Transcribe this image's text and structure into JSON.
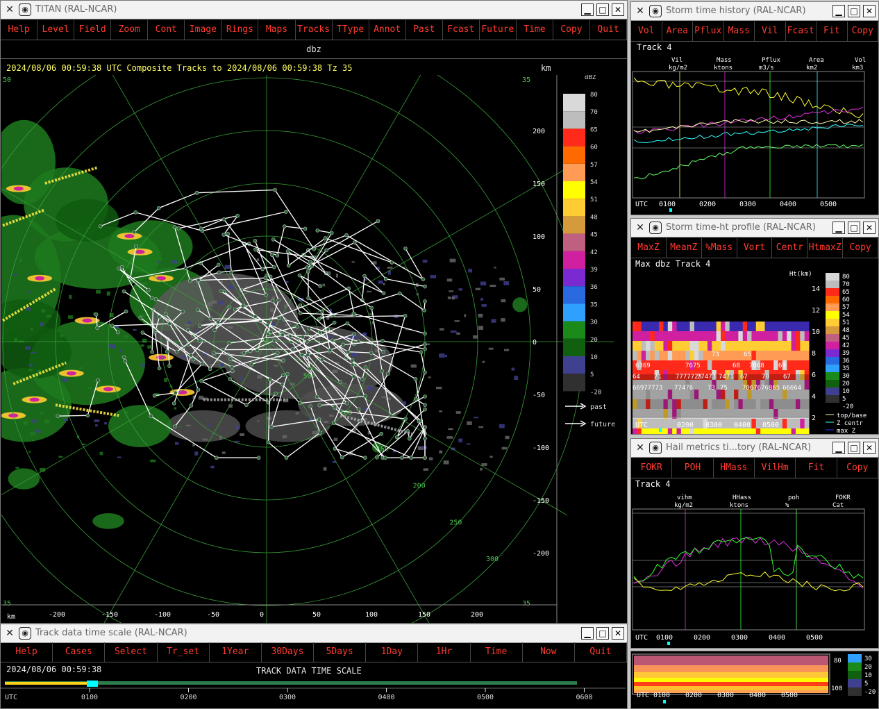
{
  "main": {
    "title": "TITAN (RAL-NCAR)",
    "menu": [
      "Help",
      "Level",
      "Field",
      "Zoom",
      "Cont",
      "Image",
      "Rings",
      "Maps",
      "Tracks",
      "TType",
      "Annot",
      "Past",
      "Fcast",
      "Future",
      "Time",
      "Copy",
      "Quit"
    ],
    "field": "dbz",
    "header": "2024/08/06 00:59:38 UTC Composite Tracks to 2024/08/06 00:59:38 Tz 35",
    "km_top": "km",
    "km_bottom": "km",
    "x_ticks": [
      "-200",
      "-150",
      "-100",
      "-50",
      "0",
      "50",
      "100",
      "150",
      "200"
    ],
    "y_ticks": [
      "200",
      "150",
      "100",
      "50",
      "0",
      "-50",
      "-100",
      "-150",
      "-200"
    ],
    "ring_labels": [
      "50",
      "100",
      "150",
      "200",
      "250",
      "300"
    ],
    "corner_labels": [
      "50",
      "35",
      "35",
      "35"
    ],
    "legend": {
      "unit": "dBZ",
      "levels": [
        "80",
        "70",
        "65",
        "60",
        "57",
        "54",
        "51",
        "48",
        "45",
        "42",
        "39",
        "36",
        "35",
        "30",
        "20",
        "10",
        "5",
        "-20"
      ],
      "colors": [
        "#d9d9d9",
        "#bdbdbd",
        "#ff2a1a",
        "#ff6a00",
        "#ff9b55",
        "#ffff00",
        "#ffcc33",
        "#d49a3c",
        "#c06080",
        "#d020a0",
        "#7a2ad0",
        "#2a6ae0",
        "#30a0ff",
        "#1a8a1a",
        "#106010",
        "#404090",
        "#303030"
      ],
      "past": "past",
      "future": "future"
    }
  },
  "time_scale": {
    "title": "Track data time scale (RAL-NCAR)",
    "menu": [
      "Help",
      "Cases",
      "Select",
      "Tr_set",
      "1Year",
      "30Days",
      "5Days",
      "1Day",
      "1Hr",
      "Time",
      "Now",
      "Quit"
    ],
    "datetime": "2024/08/06 00:59:38",
    "label": "TRACK DATA TIME SCALE",
    "utc": "UTC",
    "ticks": [
      "0100",
      "0200",
      "0300",
      "0400",
      "0500",
      "0600"
    ]
  },
  "storm_history": {
    "title": "Storm time history (RAL-NCAR)",
    "menu": [
      "Vol",
      "Area",
      "Pflux",
      "Mass",
      "Vil",
      "Fcast",
      "Fit",
      "Copy"
    ],
    "track": "Track 4",
    "cols": [
      {
        "name": "Vil",
        "unit": "kg/m2"
      },
      {
        "name": "Mass",
        "unit": "ktons"
      },
      {
        "name": "Pflux",
        "unit": "m3/s"
      },
      {
        "name": "Area",
        "unit": "km2"
      },
      {
        "name": "Vol",
        "unit": "km3"
      }
    ],
    "utc": "UTC",
    "ticks": [
      "0100",
      "0200",
      "0300",
      "0400",
      "0500"
    ]
  },
  "time_ht": {
    "title": "Storm time-ht profile (RAL-NCAR)",
    "menu": [
      "MaxZ",
      "MeanZ",
      "%Mass",
      "Vort",
      "Centr",
      "HtmaxZ",
      "Copy"
    ],
    "label": "Max dbz  Track 4",
    "ht_unit": "Ht(km)",
    "heights": [
      "14",
      "12",
      "10",
      "8",
      "6",
      "4",
      "2"
    ],
    "legend_levels": [
      "80",
      "70",
      "65",
      "60",
      "57",
      "54",
      "51",
      "48",
      "45",
      "42",
      "39",
      "36",
      "35",
      "30",
      "20",
      "10",
      "5",
      "-20"
    ],
    "legend_lines": [
      "top/base",
      "Z centr",
      "max Z"
    ],
    "utc": "UTC",
    "ticks": [
      "0200",
      "0300",
      "0400",
      "0500"
    ],
    "cell_values_upper": [
      "6369",
      "7675",
      "73",
      "68",
      "7068",
      "69",
      "65"
    ],
    "cell_values_lower": [
      "64",
      "71",
      "7777725",
      "77473",
      "7471",
      "67",
      "70",
      "67"
    ],
    "cell_values_bottom": [
      "66977773",
      "77476",
      "73",
      "75",
      "7067676865",
      "66664"
    ]
  },
  "hail": {
    "title": "Hail metrics ti...tory (RAL-NCAR)",
    "menu": [
      "FOKR",
      "POH",
      "HMass",
      "VilHm",
      "Fit",
      "Copy"
    ],
    "track": "Track 4",
    "cols": [
      {
        "name": "vihm",
        "unit": "kg/m2"
      },
      {
        "name": "HHass",
        "unit": "ktons"
      },
      {
        "name": "poh",
        "unit": "%"
      },
      {
        "name": "FOKR",
        "unit": "Cat"
      }
    ],
    "utc": "UTC",
    "ticks": [
      "0100",
      "0200",
      "0300",
      "0400",
      "0500"
    ]
  },
  "mini": {
    "right_ticks": [
      "80",
      "100"
    ],
    "legend": [
      "30",
      "20",
      "10",
      "5",
      "-20"
    ],
    "utc": "UTC",
    "ticks": [
      "0100",
      "0200",
      "0300",
      "0400",
      "0500"
    ]
  }
}
